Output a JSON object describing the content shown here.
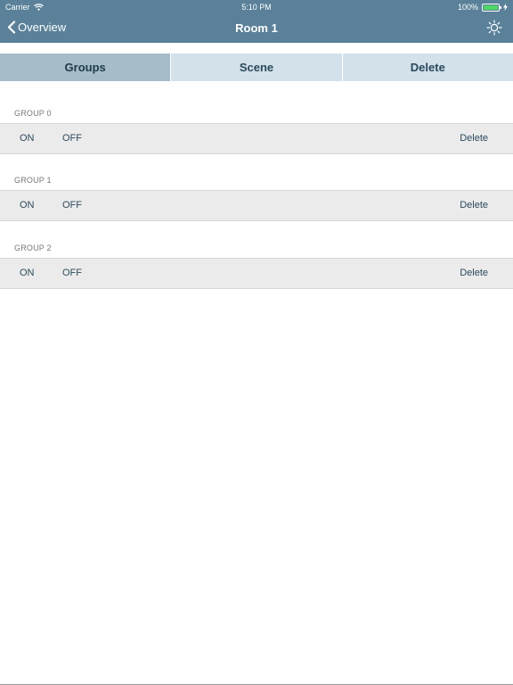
{
  "status_bar": {
    "carrier": "Carrier",
    "time": "5:10 PM",
    "battery_percent": "100%",
    "battery_level": 1.0,
    "wifi_icon": "wifi-icon",
    "charging_icon": "bolt-icon"
  },
  "nav": {
    "back_label": "Overview",
    "title": "Room 1",
    "settings_icon": "brightness-icon"
  },
  "tabs": [
    {
      "label": "Groups",
      "active": true
    },
    {
      "label": "Scene",
      "active": false
    },
    {
      "label": "Delete",
      "active": false
    }
  ],
  "groups": [
    {
      "name": "GROUP 0",
      "on_label": "ON",
      "off_label": "OFF",
      "delete_label": "Delete"
    },
    {
      "name": "GROUP 1",
      "on_label": "ON",
      "off_label": "OFF",
      "delete_label": "Delete"
    },
    {
      "name": "GROUP 2",
      "on_label": "ON",
      "off_label": "OFF",
      "delete_label": "Delete"
    }
  ],
  "colors": {
    "bar": "#5a8199",
    "tab_bg": "#d2e1ea",
    "tab_active": "#a6bcc9",
    "row_bg": "#ebebeb",
    "text": "#2b4a5c"
  }
}
